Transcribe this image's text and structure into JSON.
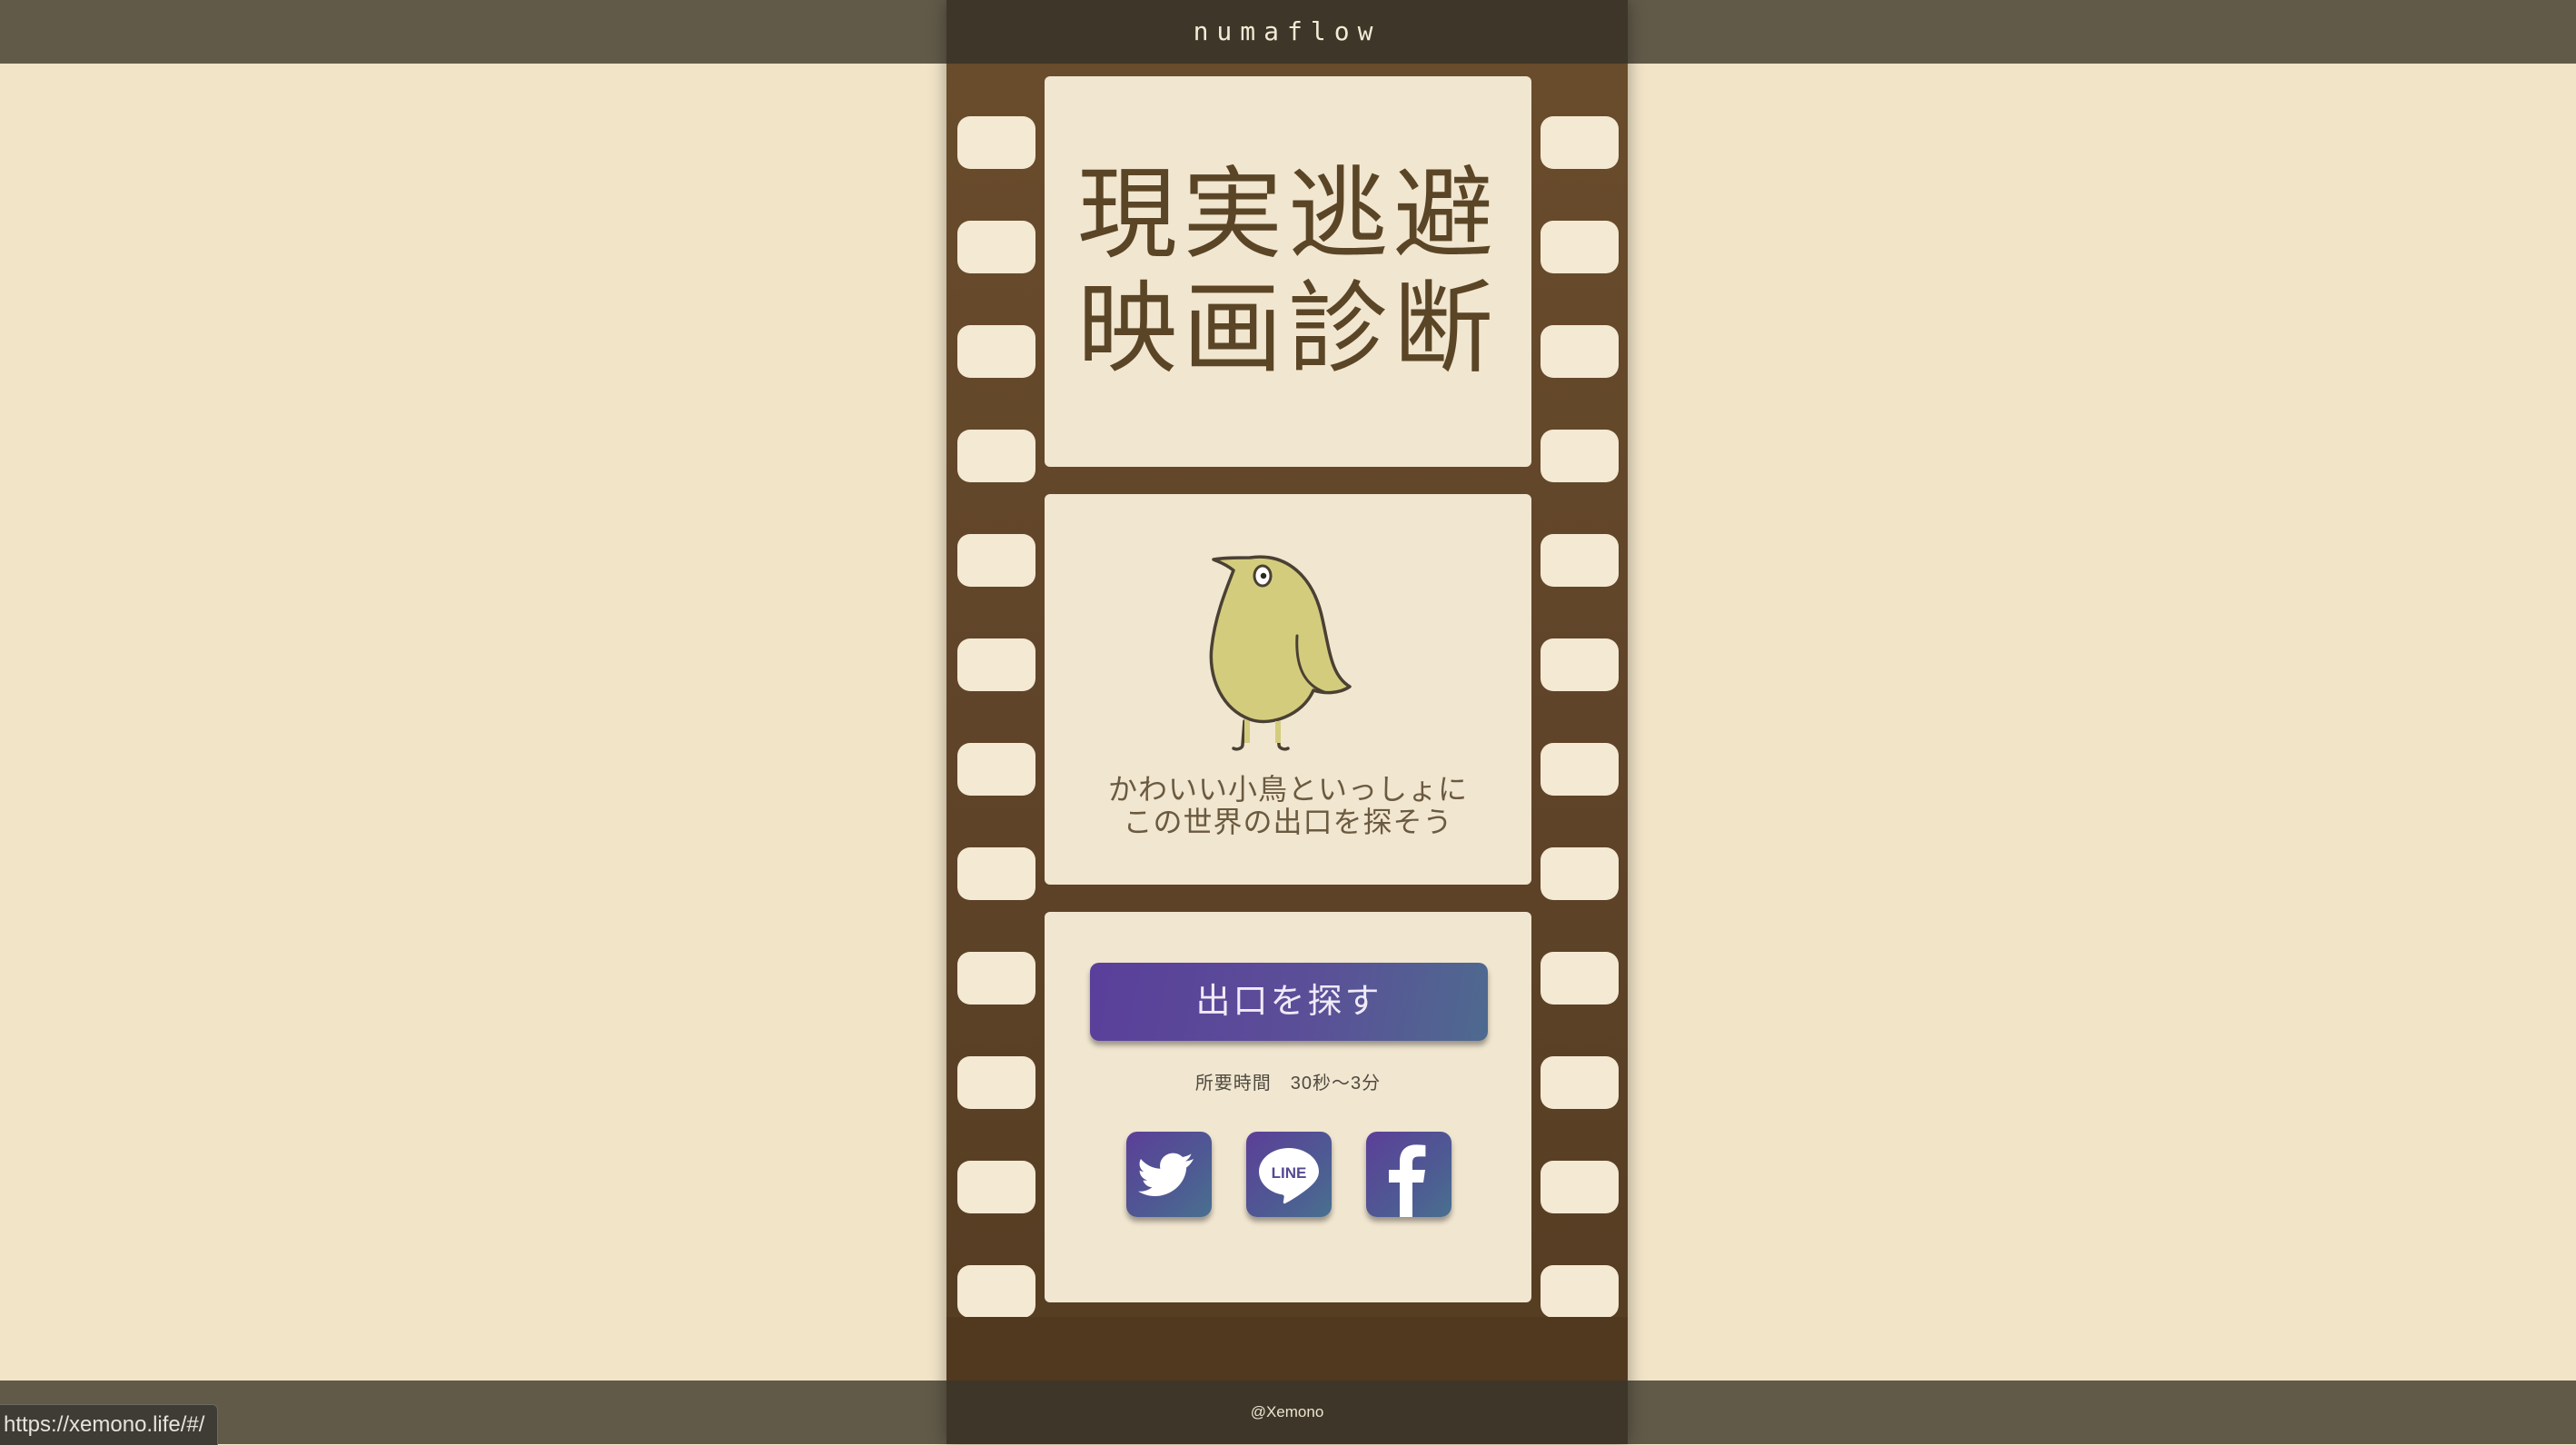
{
  "brand": "numaflow",
  "title": {
    "line1": "現実逃避",
    "line2": "映画診断"
  },
  "intro": {
    "line1": "かわいい小鳥といっしょに",
    "line2": "この世界の出口を探そう",
    "image": "yellow-bird-illustration"
  },
  "cta": {
    "label": "出口を探す",
    "duration": "所要時間　30秒〜3分"
  },
  "share": {
    "twitter_icon": "twitter-icon",
    "line_label": "LINE",
    "facebook_icon": "facebook-icon"
  },
  "footer": {
    "credit": "@Xemono"
  },
  "status_bar": {
    "url": "https://xemono.life/#/"
  },
  "colors": {
    "page_background": "#f1e4c7",
    "film_strip": "#694c2b",
    "frame": "#f1e6d0",
    "title_text": "#5a4526",
    "accent_gradient_start": "#5a3f9a",
    "accent_gradient_end": "#4e6a8f"
  }
}
